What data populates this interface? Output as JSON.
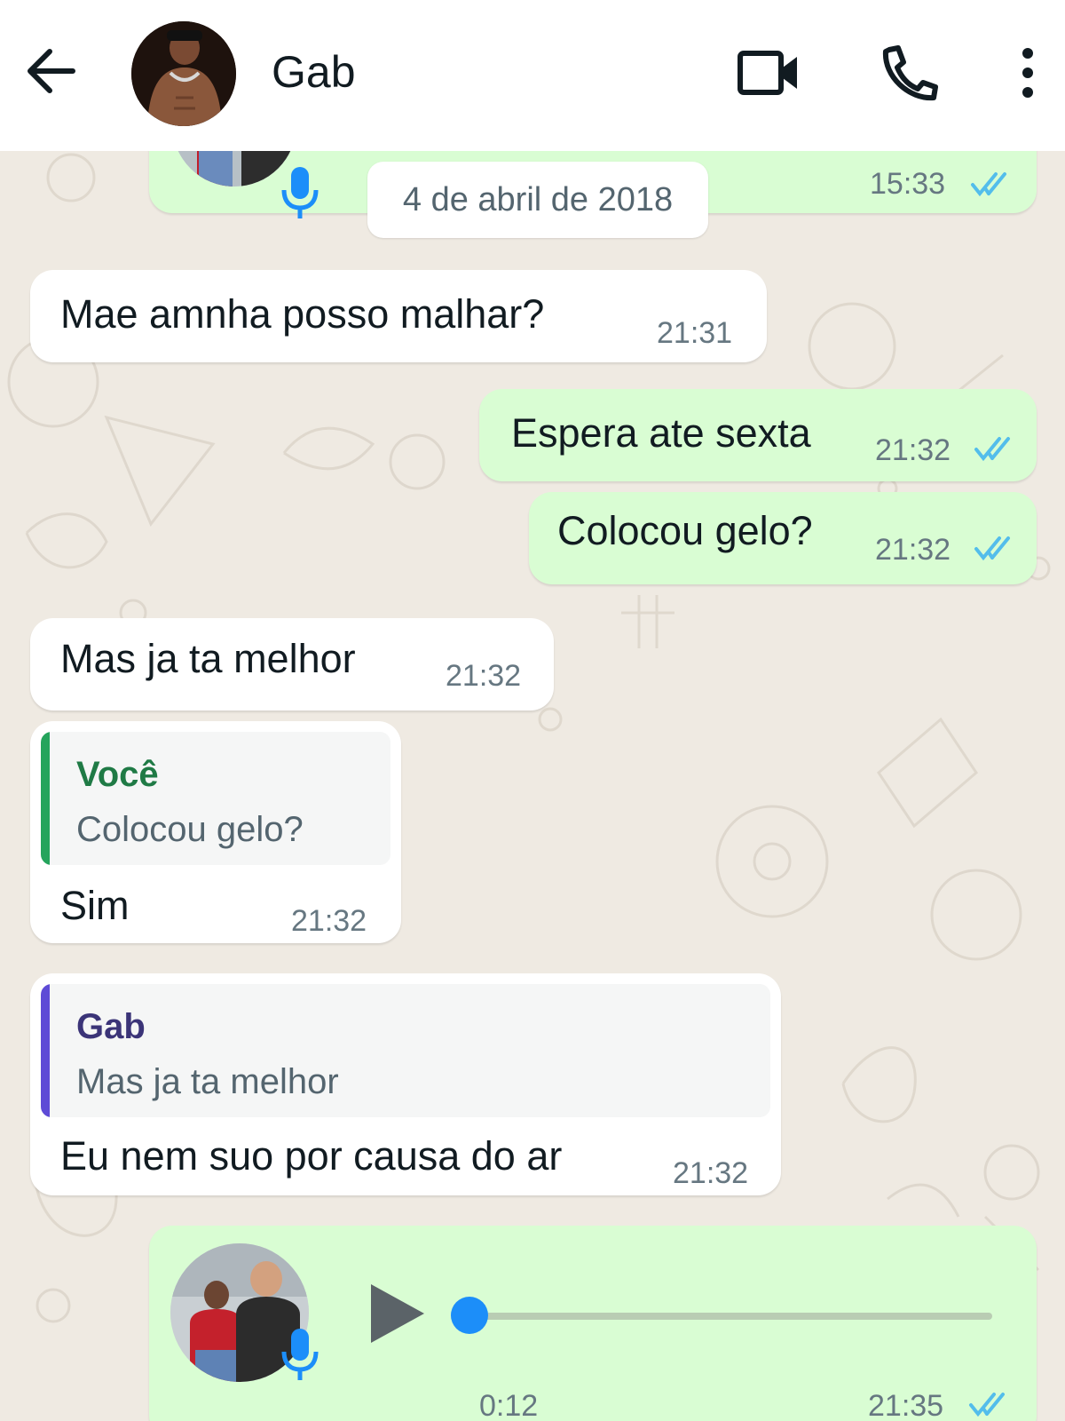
{
  "header": {
    "contact_name": "Gab",
    "icons": [
      "back-arrow-icon",
      "video-call-icon",
      "voice-call-icon",
      "more-vertical-icon"
    ]
  },
  "date_separator": "4 de abril de 2018",
  "top_voice_message": {
    "time": "15:33",
    "status": "read"
  },
  "messages": [
    {
      "direction": "in",
      "text": "Mae amnha posso malhar?",
      "time": "21:31"
    },
    {
      "direction": "out",
      "text": "Espera ate sexta",
      "time": "21:32",
      "status": "read"
    },
    {
      "direction": "out",
      "text": "Colocou gelo?",
      "time": "21:32",
      "status": "read"
    },
    {
      "direction": "in",
      "text": "Mas ja ta melhor",
      "time": "21:32"
    },
    {
      "direction": "in",
      "text": "Sim",
      "time": "21:32",
      "quote": {
        "author": "Você",
        "text": "Colocou gelo?"
      }
    },
    {
      "direction": "in",
      "text": "Eu nem suo por causa do ar",
      "time": "21:32",
      "quote": {
        "author": "Gab",
        "text": "Mas ja ta melhor"
      }
    }
  ],
  "voice_message": {
    "duration": "0:12",
    "time": "21:35",
    "status": "read",
    "progress": 0
  },
  "colors": {
    "outgoing_bubble": "#d9fdd3",
    "incoming_bubble": "#ffffff",
    "read_ticks": "#53bdeb",
    "you_quote_bar": "#25a45c",
    "gab_quote_bar": "#5e4bd6",
    "audio_dot": "#1c8ef9"
  }
}
